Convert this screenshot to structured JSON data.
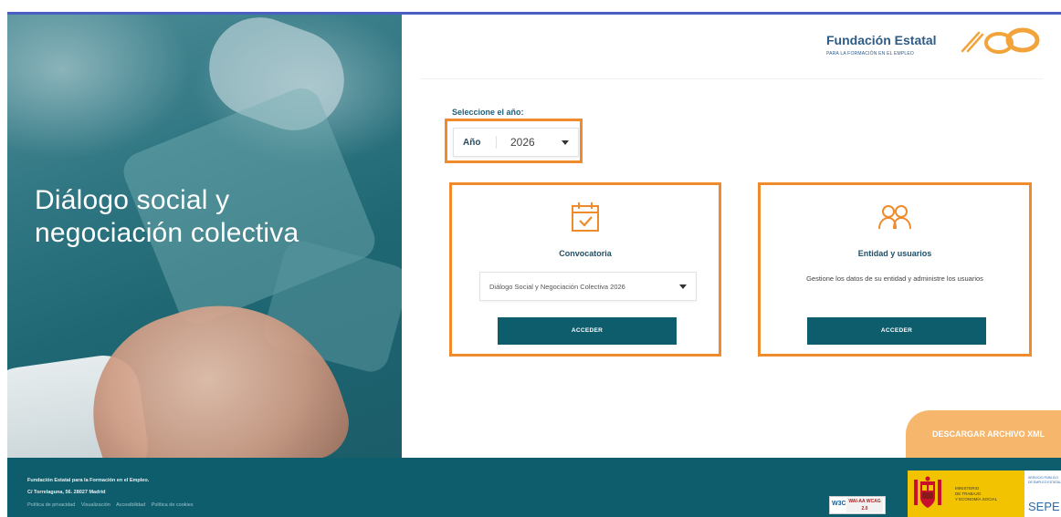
{
  "hero": {
    "title_line1": "Diálogo social y",
    "title_line2": "negociación colectiva"
  },
  "logo": {
    "name": "Fundación Estatal",
    "subtitle": "PARA LA FORMACIÓN EN EL EMPLEO"
  },
  "year_selector": {
    "label": "Seleccione el año:",
    "field_name": "Año",
    "value": "2026"
  },
  "cards": [
    {
      "icon": "calendar-check-icon",
      "title": "Convocatoria",
      "select_value": "Diálogo Social y Negociación Colectiva 2026",
      "button": "ACCEDER"
    },
    {
      "icon": "users-icon",
      "title": "Entidad y usuarios",
      "description": "Gestione los datos de su entidad y administre los usuarios",
      "button": "ACCEDER"
    }
  ],
  "download_button": "DESCARGAR ARCHIVO XML",
  "footer": {
    "line1": "Fundación Estatal para la Formación en el Empleo.",
    "line2": "C/ Torrelaguna, 56. 28027 Madrid",
    "links": [
      "Política de privacidad",
      "Visualización",
      "Accesibilidad",
      "Política de cookies"
    ],
    "w3c_badge_left": "W3C",
    "w3c_badge_right": "WAI-AA WCAG 2.0",
    "ministry": "MINISTERIO\nDE TRABAJO\nY ECONOMÍA SOCIAL",
    "sepe_small": "SERVICIO PÚBLICO\nDE EMPLEO ESTATAL",
    "sepe": "SEPE"
  },
  "colors": {
    "accent_orange": "#f08b2c",
    "primary_teal": "#0e5d6d",
    "download_orange": "#f6b66c"
  }
}
